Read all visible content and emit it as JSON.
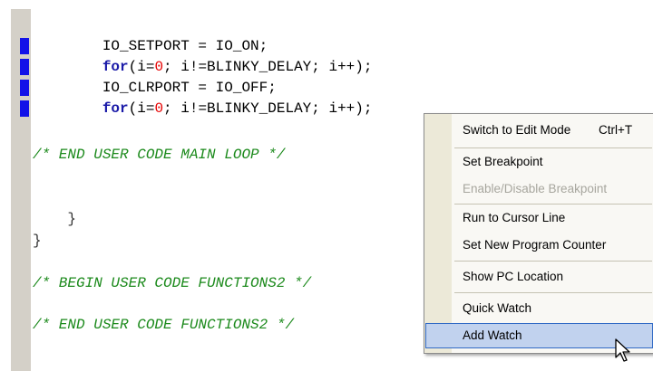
{
  "editor": {
    "lines": [
      {
        "indent": "        ",
        "plain": "IO_SETPORT = IO_ON;"
      },
      {
        "indent": "        ",
        "kw": "for",
        "a": "(i=",
        "num": "0",
        "b": "; i!=BLINKY_DELAY; i++);"
      },
      {
        "indent": "        ",
        "plain": "IO_CLRPORT = IO_OFF;"
      },
      {
        "indent": "        ",
        "kw": "for",
        "a": "(i=",
        "num": "0",
        "b": "; i!=BLINKY_DELAY; i++);"
      }
    ],
    "comment_end_main_loop": "/* END USER CODE MAIN LOOP */",
    "inner_brace": "    }",
    "outer_brace": "}",
    "comment_begin_functions2": "/* BEGIN USER CODE FUNCTIONS2 */",
    "comment_end_functions2": "/* END USER CODE FUNCTIONS2 */"
  },
  "context_menu": {
    "items": [
      {
        "label": "Switch to Edit Mode",
        "shortcut": "Ctrl+T",
        "enabled": true
      },
      {
        "label": "Set Breakpoint",
        "enabled": true
      },
      {
        "label": "Enable/Disable Breakpoint",
        "enabled": false
      },
      {
        "label": "Run to Cursor Line",
        "enabled": true
      },
      {
        "label": "Set New Program Counter",
        "enabled": true
      },
      {
        "label": "Show PC Location",
        "enabled": true
      },
      {
        "label": "Quick Watch",
        "enabled": true
      },
      {
        "label": "Add Watch",
        "enabled": true,
        "selected": true
      }
    ]
  },
  "colors": {
    "keyword": "#1a1aa8",
    "number": "#e60000",
    "comment": "#1c8a1c",
    "breakpoint_marker": "#1212e8",
    "menu_highlight": "#c1d2ee"
  },
  "icons": {
    "cursor": "mouse-pointer-icon"
  }
}
